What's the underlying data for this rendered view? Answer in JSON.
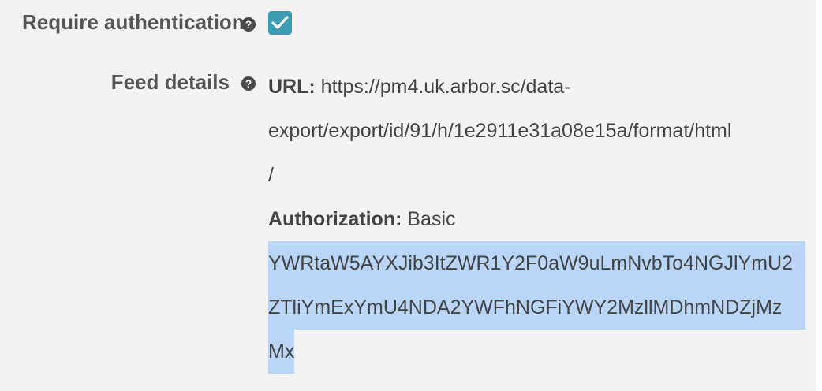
{
  "require_auth": {
    "label": "Require authentication",
    "help_icon": "question-circle-icon",
    "checked": true,
    "check_icon": "check-icon",
    "checkbox_color": "#3b9bb3"
  },
  "feed_details": {
    "label": "Feed details",
    "help_icon": "question-circle-icon",
    "url_key": "URL:",
    "url_lines": [
      "https://pm4.uk.arbor.sc/data-",
      "export/export/id/91/h/1e2911e31a08e15a/format/html",
      "/"
    ],
    "auth_key": "Authorization:",
    "auth_scheme": "Basic",
    "auth_token_lines": [
      "YWRtaW5AYXJib3ItZWR1Y2F0aW9uLmNvbTo4NGJlYmU2",
      "ZTliYmExYmU4NDA2YWFhNGFiYWY2MzllMDhmNDZjMz",
      "Mx"
    ],
    "selection_color": "#b9d6f8"
  }
}
